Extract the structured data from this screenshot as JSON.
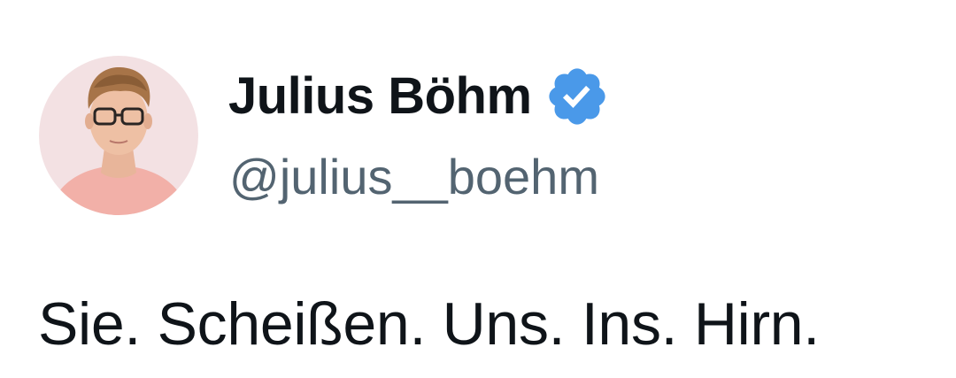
{
  "author": {
    "display_name": "Julius Böhm",
    "handle": "@julius__boehm",
    "verified": true,
    "verified_color": "#4a99e9",
    "avatar_icon": "profile-photo"
  },
  "tweet": {
    "text": "Sie. Scheißen. Uns. Ins. Hirn."
  },
  "colors": {
    "text_primary": "#0f1419",
    "text_secondary": "#536471",
    "background": "#ffffff"
  }
}
